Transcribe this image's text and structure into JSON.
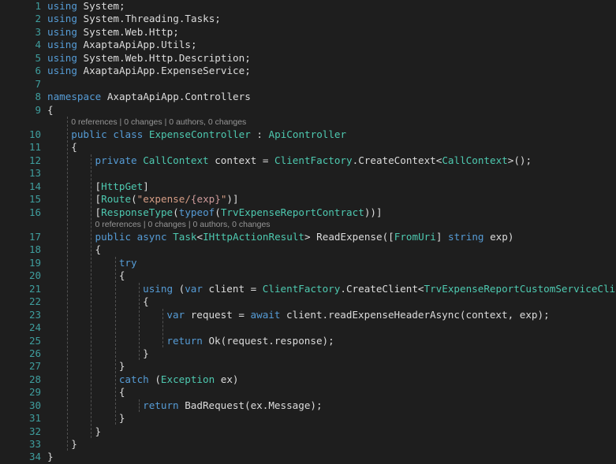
{
  "editor": {
    "background": "#1e1e1e",
    "gutter_color": "#3f9e9e",
    "default_text_color": "#dcdcdc",
    "colors": {
      "keyword": "#569cd6",
      "type": "#4ec9b0",
      "string": "#d69d85",
      "format_brace": "#cd9a9a",
      "codelens": "#969696",
      "indent_guide": "#5a5a5a"
    },
    "indent_guide_x": [
      85,
      118,
      151,
      184,
      217
    ],
    "total_lines": 34,
    "lines": [
      {
        "number": "1",
        "indent": 0,
        "tokens": [
          {
            "text": "using",
            "cls": "k"
          },
          {
            "text": " System;",
            "cls": "p"
          }
        ]
      },
      {
        "number": "2",
        "indent": 0,
        "tokens": [
          {
            "text": "using",
            "cls": "k"
          },
          {
            "text": " System.Threading.Tasks;",
            "cls": "p"
          }
        ]
      },
      {
        "number": "3",
        "indent": 0,
        "tokens": [
          {
            "text": "using",
            "cls": "k"
          },
          {
            "text": " System.Web.Http;",
            "cls": "p"
          }
        ]
      },
      {
        "number": "4",
        "indent": 0,
        "tokens": [
          {
            "text": "using",
            "cls": "k"
          },
          {
            "text": " AxaptaApiApp.Utils;",
            "cls": "p"
          }
        ]
      },
      {
        "number": "5",
        "indent": 0,
        "tokens": [
          {
            "text": "using",
            "cls": "k"
          },
          {
            "text": " System.Web.Http.Description;",
            "cls": "p"
          }
        ]
      },
      {
        "number": "6",
        "indent": 0,
        "tokens": [
          {
            "text": "using",
            "cls": "k"
          },
          {
            "text": " AxaptaApiApp.ExpenseService;",
            "cls": "p"
          }
        ]
      },
      {
        "number": "7",
        "indent": 0,
        "tokens": []
      },
      {
        "number": "8",
        "indent": 0,
        "tokens": [
          {
            "text": "namespace",
            "cls": "k"
          },
          {
            "text": " AxaptaApiApp.Controllers",
            "cls": "p"
          }
        ]
      },
      {
        "number": "9",
        "indent": 0,
        "tokens": [
          {
            "text": "{",
            "cls": "p"
          }
        ]
      },
      {
        "codelens": true,
        "text": "0 references | 0 changes | 0 authors, 0 changes",
        "indent": 1
      },
      {
        "number": "10",
        "indent": 1,
        "tokens": [
          {
            "text": "public",
            "cls": "k"
          },
          {
            "text": " ",
            "cls": "p"
          },
          {
            "text": "class",
            "cls": "k"
          },
          {
            "text": " ",
            "cls": "p"
          },
          {
            "text": "ExpenseController",
            "cls": "t"
          },
          {
            "text": " : ",
            "cls": "p"
          },
          {
            "text": "ApiController",
            "cls": "t"
          }
        ]
      },
      {
        "number": "11",
        "indent": 1,
        "tokens": [
          {
            "text": "{",
            "cls": "p"
          }
        ]
      },
      {
        "number": "12",
        "indent": 2,
        "tokens": [
          {
            "text": "private",
            "cls": "k"
          },
          {
            "text": " ",
            "cls": "p"
          },
          {
            "text": "CallContext",
            "cls": "t"
          },
          {
            "text": " context = ",
            "cls": "p"
          },
          {
            "text": "ClientFactory",
            "cls": "t"
          },
          {
            "text": ".CreateContext<",
            "cls": "p"
          },
          {
            "text": "CallContext",
            "cls": "t"
          },
          {
            "text": ">();",
            "cls": "p"
          }
        ]
      },
      {
        "number": "13",
        "indent": 2,
        "tokens": []
      },
      {
        "number": "14",
        "indent": 2,
        "tokens": [
          {
            "text": "[",
            "cls": "p"
          },
          {
            "text": "HttpGet",
            "cls": "t"
          },
          {
            "text": "]",
            "cls": "p"
          }
        ]
      },
      {
        "number": "15",
        "indent": 2,
        "tokens": [
          {
            "text": "[",
            "cls": "p"
          },
          {
            "text": "Route",
            "cls": "t"
          },
          {
            "text": "(",
            "cls": "p"
          },
          {
            "text": "\"expense/",
            "cls": "s"
          },
          {
            "text": "{exp}",
            "cls": "fm"
          },
          {
            "text": "\"",
            "cls": "s"
          },
          {
            "text": ")]",
            "cls": "p"
          }
        ]
      },
      {
        "number": "16",
        "indent": 2,
        "tokens": [
          {
            "text": "[",
            "cls": "p"
          },
          {
            "text": "ResponseType",
            "cls": "t"
          },
          {
            "text": "(",
            "cls": "p"
          },
          {
            "text": "typeof",
            "cls": "k"
          },
          {
            "text": "(",
            "cls": "p"
          },
          {
            "text": "TrvExpenseReportContract",
            "cls": "t"
          },
          {
            "text": "))]",
            "cls": "p"
          }
        ]
      },
      {
        "codelens": true,
        "text": "0 references | 0 changes | 0 authors, 0 changes",
        "indent": 2
      },
      {
        "number": "17",
        "indent": 2,
        "tokens": [
          {
            "text": "public",
            "cls": "k"
          },
          {
            "text": " ",
            "cls": "p"
          },
          {
            "text": "async",
            "cls": "k"
          },
          {
            "text": " ",
            "cls": "p"
          },
          {
            "text": "Task",
            "cls": "t"
          },
          {
            "text": "<",
            "cls": "p"
          },
          {
            "text": "IHttpActionResult",
            "cls": "t"
          },
          {
            "text": "> ReadExpense([",
            "cls": "p"
          },
          {
            "text": "FromUri",
            "cls": "t"
          },
          {
            "text": "] ",
            "cls": "p"
          },
          {
            "text": "string",
            "cls": "k"
          },
          {
            "text": " exp)",
            "cls": "p"
          }
        ]
      },
      {
        "number": "18",
        "indent": 2,
        "tokens": [
          {
            "text": "{",
            "cls": "p"
          }
        ]
      },
      {
        "number": "19",
        "indent": 3,
        "tokens": [
          {
            "text": "try",
            "cls": "ctl"
          }
        ]
      },
      {
        "number": "20",
        "indent": 3,
        "tokens": [
          {
            "text": "{",
            "cls": "p"
          }
        ]
      },
      {
        "number": "21",
        "indent": 4,
        "tokens": [
          {
            "text": "using",
            "cls": "k"
          },
          {
            "text": " (",
            "cls": "p"
          },
          {
            "text": "var",
            "cls": "k"
          },
          {
            "text": " client = ",
            "cls": "p"
          },
          {
            "text": "ClientFactory",
            "cls": "t"
          },
          {
            "text": ".CreateClient<",
            "cls": "p"
          },
          {
            "text": "TrvExpenseReportCustomServiceClient",
            "cls": "t"
          },
          {
            "text": ">())",
            "cls": "p"
          }
        ]
      },
      {
        "number": "22",
        "indent": 4,
        "tokens": [
          {
            "text": "{",
            "cls": "p"
          }
        ]
      },
      {
        "number": "23",
        "indent": 5,
        "tokens": [
          {
            "text": "var",
            "cls": "k"
          },
          {
            "text": " request = ",
            "cls": "p"
          },
          {
            "text": "await",
            "cls": "k"
          },
          {
            "text": " client.readExpenseHeaderAsync(context, exp);",
            "cls": "p"
          }
        ]
      },
      {
        "number": "24",
        "indent": 5,
        "tokens": []
      },
      {
        "number": "25",
        "indent": 5,
        "tokens": [
          {
            "text": "return",
            "cls": "ctl"
          },
          {
            "text": " Ok(request.response);",
            "cls": "p"
          }
        ]
      },
      {
        "number": "26",
        "indent": 4,
        "tokens": [
          {
            "text": "}",
            "cls": "p"
          }
        ]
      },
      {
        "number": "27",
        "indent": 3,
        "tokens": [
          {
            "text": "}",
            "cls": "p"
          }
        ]
      },
      {
        "number": "28",
        "indent": 3,
        "tokens": [
          {
            "text": "catch",
            "cls": "ctl"
          },
          {
            "text": " (",
            "cls": "p"
          },
          {
            "text": "Exception",
            "cls": "t"
          },
          {
            "text": " ex)",
            "cls": "p"
          }
        ]
      },
      {
        "number": "29",
        "indent": 3,
        "tokens": [
          {
            "text": "{",
            "cls": "p"
          }
        ]
      },
      {
        "number": "30",
        "indent": 4,
        "tokens": [
          {
            "text": "return",
            "cls": "ctl"
          },
          {
            "text": " BadRequest(ex.Message);",
            "cls": "p"
          }
        ]
      },
      {
        "number": "31",
        "indent": 3,
        "tokens": [
          {
            "text": "}",
            "cls": "p"
          }
        ]
      },
      {
        "number": "32",
        "indent": 2,
        "tokens": [
          {
            "text": "}",
            "cls": "p"
          }
        ]
      },
      {
        "number": "33",
        "indent": 1,
        "tokens": [
          {
            "text": "}",
            "cls": "p"
          }
        ]
      },
      {
        "number": "34",
        "indent": 0,
        "tokens": [
          {
            "text": "}",
            "cls": "p"
          }
        ]
      }
    ]
  }
}
